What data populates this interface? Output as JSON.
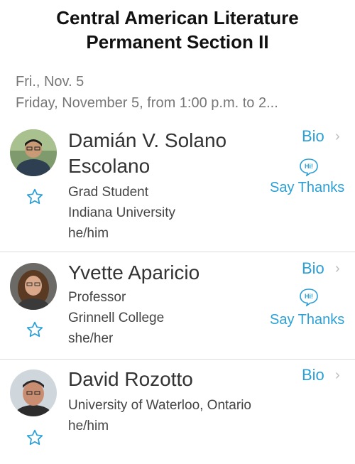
{
  "header": {
    "title_line1": "Central American Literature",
    "title_line2": "Permanent Section II"
  },
  "session": {
    "date": "Fri., Nov. 5",
    "time_range": "Friday, November 5, from 1:00 p.m. to 2..."
  },
  "colors": {
    "accent": "#2a9fd6",
    "text": "#333333",
    "muted": "#777777"
  },
  "people": [
    {
      "name_line1": "Damián V. Solano",
      "name_line2": "Escolano",
      "role": "Grad Student",
      "affiliation": "Indiana University",
      "pronouns": "he/him",
      "bio_label": "Bio",
      "thanks_label": "Say Thanks",
      "hi_label": "Hi!"
    },
    {
      "name": "Yvette Aparicio",
      "role": "Professor",
      "affiliation": "Grinnell College",
      "pronouns": "she/her",
      "bio_label": "Bio",
      "thanks_label": "Say Thanks",
      "hi_label": "Hi!"
    },
    {
      "name": "David Rozotto",
      "affiliation": "University of Waterloo, Ontario",
      "pronouns": "he/him",
      "bio_label": "Bio"
    }
  ]
}
